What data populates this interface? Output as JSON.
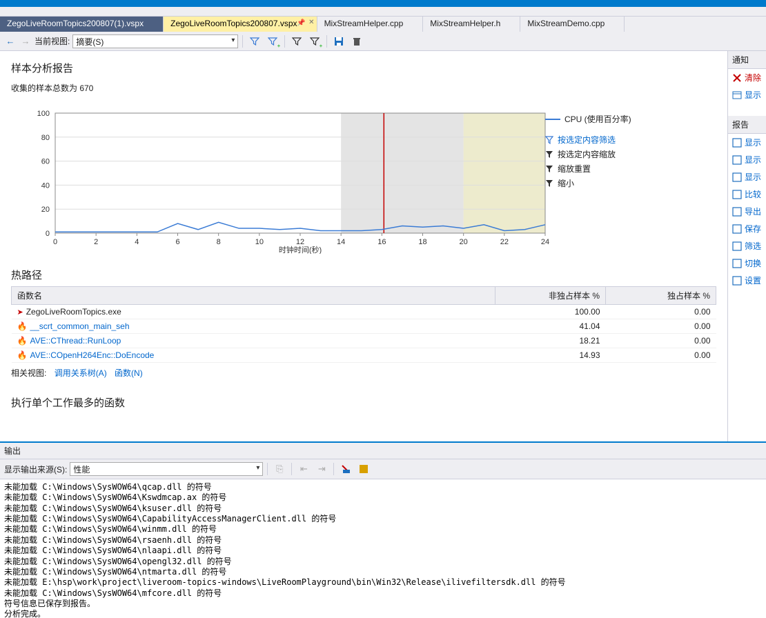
{
  "tabs": [
    {
      "label": "ZegoLiveRoomTopics200807(1).vspx",
      "active": false,
      "dark": true
    },
    {
      "label": "ZegoLiveRoomTopics200807.vspx",
      "active": true,
      "dark": false
    },
    {
      "label": "MixStreamHelper.cpp",
      "active": false,
      "dark": false
    },
    {
      "label": "MixStreamHelper.h",
      "active": false,
      "dark": false
    },
    {
      "label": "MixStreamDemo.cpp",
      "active": false,
      "dark": false
    }
  ],
  "toolbar": {
    "view_label": "当前视图:",
    "view_value": "摘要(S)"
  },
  "report": {
    "title": "样本分析报告",
    "subtitle": "收集的样本总数为 670",
    "legend": "CPU (使用百分率)",
    "actions": {
      "filter": "按选定内容筛选",
      "zoom": "按选定内容缩放",
      "reset": "缩放重置",
      "shrink": "缩小"
    },
    "xlabel": "时钟时间(秒)",
    "hotpath_title": "热路径",
    "cols": {
      "fn": "函数名",
      "incl": "非独占样本 %",
      "excl": "独占样本 %"
    },
    "rows": [
      {
        "name": "ZegoLiveRoomTopics.exe",
        "incl": "100.00",
        "excl": "0.00",
        "root": true
      },
      {
        "name": "__scrt_common_main_seh",
        "incl": "41.04",
        "excl": "0.00"
      },
      {
        "name": "AVE::CThread::RunLoop",
        "incl": "18.21",
        "excl": "0.00"
      },
      {
        "name": "AVE::COpenH264Enc::DoEncode",
        "incl": "14.93",
        "excl": "0.00"
      }
    ],
    "related_label": "相关视图:",
    "related_links": [
      "调用关系树(A)",
      "函数(N)"
    ],
    "top_fn_title": "执行单个工作最多的函数"
  },
  "chart_data": {
    "type": "line",
    "title": "CPU (使用百分率)",
    "xlabel": "时钟时间(秒)",
    "ylabel": "",
    "xlim": [
      0,
      24
    ],
    "ylim": [
      0,
      100
    ],
    "xticks": [
      0,
      2,
      4,
      6,
      8,
      10,
      12,
      14,
      16,
      18,
      20,
      22,
      24
    ],
    "yticks": [
      0,
      20,
      40,
      60,
      80,
      100
    ],
    "series": [
      {
        "name": "CPU (使用百分率)",
        "x": [
          0,
          1,
          2,
          3,
          4,
          5,
          6,
          7,
          8,
          9,
          10,
          11,
          12,
          13,
          14,
          15,
          16,
          17,
          18,
          19,
          20,
          21,
          22,
          23,
          24
        ],
        "y": [
          1,
          1,
          1,
          1,
          1,
          1,
          8,
          3,
          9,
          4,
          4,
          3,
          4,
          2,
          2,
          2,
          3,
          6,
          5,
          6,
          4,
          7,
          2,
          3,
          7
        ]
      }
    ],
    "highlight": {
      "x": [
        14,
        20
      ],
      "color": "#d9d9d9"
    },
    "highlight2": {
      "x": [
        20,
        24
      ],
      "color": "#e6e2b8"
    },
    "marker_line": {
      "x": 16.1,
      "color": "#c40000"
    }
  },
  "side": {
    "notify_header": "通知",
    "notify_clear": "清除",
    "notify_show": "显示",
    "report_header": "报告",
    "items": [
      {
        "label": "显示",
        "icon": "grid"
      },
      {
        "label": "显示",
        "icon": "list"
      },
      {
        "label": "显示",
        "icon": "cols"
      },
      {
        "label": "比较",
        "icon": "compare"
      },
      {
        "label": "导出",
        "icon": "export"
      },
      {
        "label": "保存",
        "icon": "save"
      },
      {
        "label": "筛选",
        "icon": "filter"
      },
      {
        "label": "切换",
        "icon": "switch"
      },
      {
        "label": "设置",
        "icon": "gear"
      }
    ]
  },
  "output": {
    "title": "输出",
    "src_label": "显示输出来源(S):",
    "src_value": "性能",
    "lines": [
      "未能加载 C:\\Windows\\SysWOW64\\qcap.dll 的符号",
      "未能加载 C:\\Windows\\SysWOW64\\Kswdmcap.ax 的符号",
      "未能加载 C:\\Windows\\SysWOW64\\ksuser.dll 的符号",
      "未能加载 C:\\Windows\\SysWOW64\\CapabilityAccessManagerClient.dll 的符号",
      "未能加载 C:\\Windows\\SysWOW64\\winmm.dll 的符号",
      "未能加载 C:\\Windows\\SysWOW64\\rsaenh.dll 的符号",
      "未能加载 C:\\Windows\\SysWOW64\\nlaapi.dll 的符号",
      "未能加载 C:\\Windows\\SysWOW64\\opengl32.dll 的符号",
      "未能加载 C:\\Windows\\SysWOW64\\ntmarta.dll 的符号",
      "未能加载 E:\\hsp\\work\\project\\liveroom-topics-windows\\LiveRoomPlayground\\bin\\Win32\\Release\\ilivefiltersdk.dll 的符号",
      "未能加载 C:\\Windows\\SysWOW64\\mfcore.dll 的符号",
      "符号信息已保存到报告。",
      "分析完成。"
    ]
  }
}
